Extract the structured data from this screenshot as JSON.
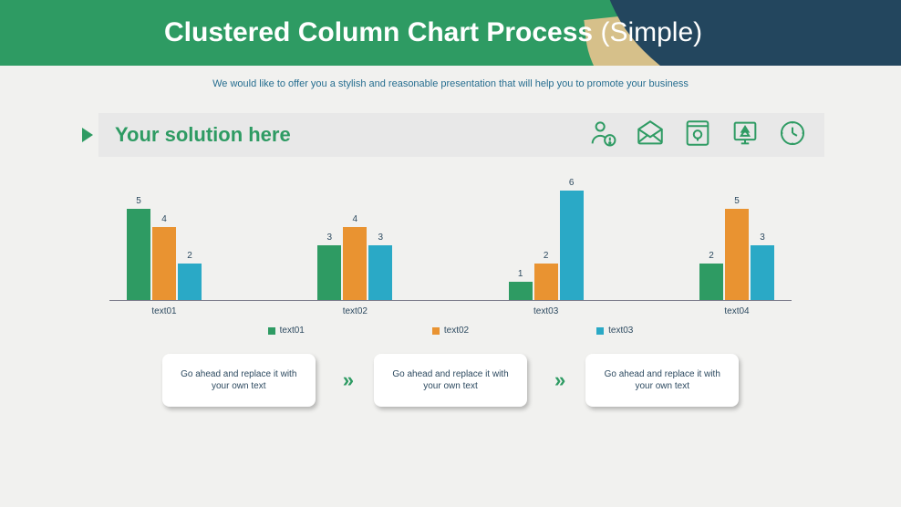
{
  "header": {
    "title_bold": "Clustered Column Chart Process",
    "title_light": "(Simple)"
  },
  "subtitle": "We would like to offer you a stylish and reasonable presentation that will help you to promote your business",
  "banner": {
    "title": "Your solution here",
    "icons": [
      "person-alert-icon",
      "mail-open-icon",
      "book-lightbulb-icon",
      "board-tree-icon",
      "clock-icon"
    ]
  },
  "chart_data": {
    "type": "bar",
    "categories": [
      "text01",
      "text02",
      "text03",
      "text04"
    ],
    "series": [
      {
        "name": "text01",
        "values": [
          5,
          3,
          1,
          2
        ],
        "color": "#2e9b63"
      },
      {
        "name": "text02",
        "values": [
          4,
          4,
          2,
          5
        ],
        "color": "#e99331"
      },
      {
        "name": "text03",
        "values": [
          2,
          3,
          6,
          3
        ],
        "color": "#2aa9c6"
      }
    ],
    "ylim": [
      0,
      6
    ]
  },
  "process": {
    "cards": [
      "Go ahead and replace it with your own text",
      "Go ahead and replace it with your own text",
      "Go ahead and replace it with your own text"
    ],
    "chevron": "»"
  }
}
